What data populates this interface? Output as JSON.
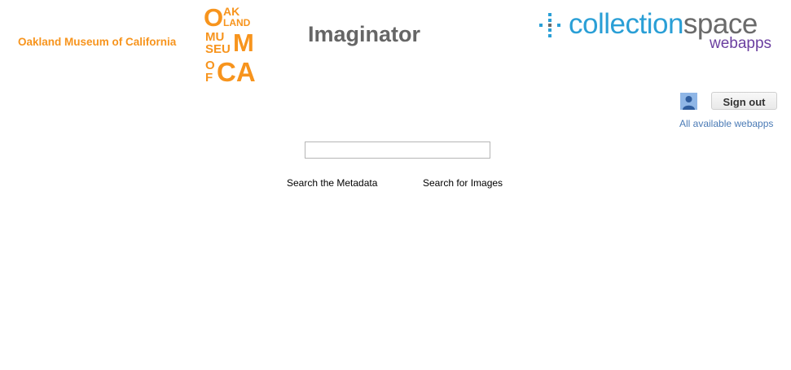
{
  "header": {
    "museum_name": "Oakland Museum of California",
    "app_title": "Imaginator",
    "omca_logo": {
      "row1": "O",
      "row1_small": [
        "AK"
      ],
      "row2_small": [
        "LAND"
      ],
      "row3_small": [
        "MU",
        "M"
      ],
      "row4_small": [
        "SEU"
      ],
      "row5": "CA",
      "row5_small": [
        "O",
        "F"
      ]
    },
    "cs_logo": {
      "word_part1": "collection",
      "word_part2": "space",
      "subtitle": "webapps"
    },
    "colors": {
      "omca_orange": "#f7941d",
      "cs_blue": "#2a9fd6",
      "cs_gray": "#6a6a6a",
      "cs_purple": "#6b3fa0",
      "title_gray": "#666666",
      "link_blue": "#4a7ab5"
    }
  },
  "user": {
    "icon": "user-avatar-icon",
    "signout_label": "Sign out",
    "webapps_link": "All available webapps"
  },
  "search": {
    "query_value": "",
    "placeholder": "",
    "metadata_button": "Search the Metadata",
    "images_button": "Search for Images"
  }
}
